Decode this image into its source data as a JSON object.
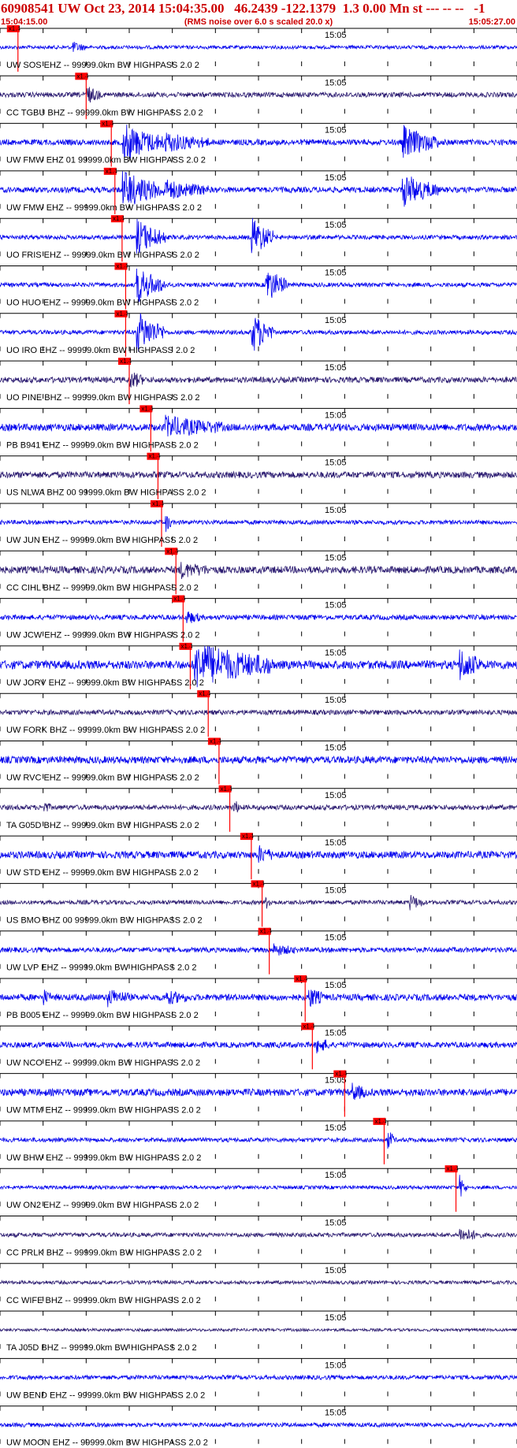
{
  "header": {
    "title": "60908541 UW Oct 23, 2014 15:04:35.00   46.2439 -122.1379  1.3 0.00 Mn st --- -- --   -1",
    "start_time": "15:04:15.00",
    "end_time": "15:05:27.00",
    "rms_note": "(RMS noise over 6.0 s scaled 20.0 x)"
  },
  "chart_data": {
    "type": "line",
    "x_start": "15:04:15.00",
    "x_end": "15:05:27.00",
    "x_tick_label": "15:05",
    "pick_label": "x1.4",
    "colors": {
      "blue": "#0000ee",
      "purple": "#2a1a70",
      "pick": "#ff0000",
      "pick_box": "#ff0000"
    },
    "traces": [
      {
        "label": "UW SOS EHZ -- 99999.0km BW  HIGHPASS  2.0  2",
        "color": "blue",
        "pick_s": 2.5,
        "amp": 0.25,
        "bursts": [
          [
            10,
            0.7,
            2
          ]
        ]
      },
      {
        "label": "CC TGBU BHZ -- 99999.0km BW  HIGHPASS  2.0  2",
        "color": "purple",
        "pick_s": 12.0,
        "amp": 0.35,
        "bursts": [
          [
            12,
            1.2,
            2
          ]
        ]
      },
      {
        "label": "UW FMW EHZ 01 99999.0km BW  HIGHPASS  2.0  2",
        "color": "blue",
        "pick_s": 15.5,
        "amp": 0.4,
        "bursts": [
          [
            17,
            2.6,
            6
          ],
          [
            23,
            1.2,
            6
          ],
          [
            56,
            2.2,
            5
          ]
        ]
      },
      {
        "label": "UW FMW EHZ -- 99999.0km BW  HIGHPASS  2.0  2",
        "color": "blue",
        "pick_s": 16.0,
        "amp": 0.4,
        "bursts": [
          [
            17,
            2.6,
            6
          ],
          [
            23,
            1.2,
            6
          ],
          [
            56,
            2.2,
            5
          ]
        ]
      },
      {
        "label": "UO FRIS EHZ -- 99999.0km BW  HIGHPASS  2.0  2",
        "color": "blue",
        "pick_s": 17.0,
        "amp": 0.3,
        "bursts": [
          [
            19,
            2.6,
            4
          ],
          [
            35,
            3.0,
            3
          ]
        ]
      },
      {
        "label": "UO HUO EHZ -- 99999.0km BW  HIGHPASS  2.0  2",
        "color": "blue",
        "pick_s": 17.5,
        "amp": 0.3,
        "bursts": [
          [
            19,
            2.6,
            4
          ],
          [
            37,
            2.6,
            3
          ]
        ]
      },
      {
        "label": "UO IRO EHZ -- 99999.0km BW  HIGHPASS  2.0  2",
        "color": "blue",
        "pick_s": 17.5,
        "amp": 0.3,
        "bursts": [
          [
            19,
            3.0,
            4
          ],
          [
            35,
            3.0,
            3
          ]
        ]
      },
      {
        "label": "UO PINE BHZ -- 99999.0km BW  HIGHPASS  2.0  2",
        "color": "purple",
        "pick_s": 18.0,
        "amp": 0.4,
        "bursts": [
          [
            18,
            1.2,
            2
          ]
        ]
      },
      {
        "label": "PB B941 EHZ -- 99999.0km BW  HIGHPASS  2.0  2",
        "color": "blue",
        "pick_s": 21.0,
        "amp": 0.5,
        "bursts": [
          [
            23,
            1.3,
            8
          ]
        ]
      },
      {
        "label": "US NLWA BHZ 00 99999.0km BW  HIGHPASS  2.0  2",
        "color": "purple",
        "pick_s": 22.0,
        "amp": 0.45,
        "bursts": []
      },
      {
        "label": "UW JUN EHZ -- 99999.0km BW  HIGHPASS  2.0  2",
        "color": "blue",
        "pick_s": 22.5,
        "amp": 0.3,
        "bursts": [
          [
            23,
            1.4,
            1
          ]
        ]
      },
      {
        "label": "CC CIHL BHZ -- 99999.0km BW  HIGHPASS  2.0  2",
        "color": "purple",
        "pick_s": 24.5,
        "amp": 0.5,
        "bursts": [
          [
            25,
            0.9,
            4
          ]
        ]
      },
      {
        "label": "UW JCW EHZ -- 99999.0km BW  HIGHPASS  2.0  2",
        "color": "blue",
        "pick_s": 25.5,
        "amp": 0.35,
        "bursts": [
          [
            26,
            0.8,
            2
          ]
        ]
      },
      {
        "label": "UW JORV EHZ -- 99999.0km BW  HIGHPASS  2.0  2",
        "color": "blue",
        "pick_s": 26.5,
        "amp": 0.6,
        "bursts": [
          [
            27,
            3.0,
            11
          ],
          [
            64,
            2.0,
            3
          ]
        ]
      },
      {
        "label": "UW FORK BHZ -- 99999.0km BW  HIGHPASS  2.0  2",
        "color": "purple",
        "pick_s": 29.0,
        "amp": 0.35,
        "bursts": []
      },
      {
        "label": "UW RVC EHZ -- 99999.0km BW  HIGHPASS  2.0  2",
        "color": "blue",
        "pick_s": 30.5,
        "amp": 0.5,
        "bursts": []
      },
      {
        "label": "TA G05D BHZ -- 99999.0km BW  HIGHPASS  2.0  2",
        "color": "purple",
        "pick_s": 32.0,
        "amp": 0.35,
        "bursts": [
          [
            32.5,
            1.0,
            1
          ],
          [
            6,
            0.8,
            1
          ]
        ]
      },
      {
        "label": "UW STD EHZ -- 99999.0km BW  HIGHPASS  2.0  2",
        "color": "blue",
        "pick_s": 35.0,
        "amp": 0.5,
        "bursts": [
          [
            36,
            1.0,
            2
          ]
        ]
      },
      {
        "label": "US BMO BHZ 00 99999.0km BW  HIGHPASS  2.0  2",
        "color": "purple",
        "pick_s": 36.5,
        "amp": 0.3,
        "bursts": [
          [
            37,
            0.8,
            1
          ],
          [
            57,
            1.0,
            2
          ]
        ]
      },
      {
        "label": "UW LVP EHZ -- 99999.0km BW  HIGHPASS  2.0  2",
        "color": "blue",
        "pick_s": 37.5,
        "amp": 0.35,
        "bursts": [
          [
            38,
            0.7,
            3
          ]
        ]
      },
      {
        "label": "PB B005 EHZ -- 99999.0km BW  HIGHPASS  2.0  2",
        "color": "blue",
        "pick_s": 42.5,
        "amp": 0.45,
        "bursts": [
          [
            6,
            1.0,
            1
          ],
          [
            15,
            1.0,
            3
          ],
          [
            23,
            0.8,
            3
          ],
          [
            43,
            1.3,
            2
          ]
        ]
      },
      {
        "label": "UW NCO EHZ -- 99999.0km BW  HIGHPASS  2.0  2",
        "color": "blue",
        "pick_s": 43.5,
        "amp": 0.4,
        "bursts": [
          [
            44,
            1.0,
            2
          ]
        ]
      },
      {
        "label": "UW MTM EHZ -- 99999.0km BW  HIGHPASS  2.0  2",
        "color": "blue",
        "pick_s": 48.0,
        "amp": 0.5,
        "bursts": [
          [
            49,
            1.0,
            2
          ]
        ]
      },
      {
        "label": "UW BHW EHZ -- 99999.0km BW  HIGHPASS  2.0  2",
        "color": "blue",
        "pick_s": 53.5,
        "amp": 0.3,
        "bursts": [
          [
            54,
            1.4,
            1
          ]
        ]
      },
      {
        "label": "UW ON2 EHZ -- 99999.0km BW  HIGHPASS  2.0  2",
        "color": "blue",
        "pick_s": 63.5,
        "amp": 0.25,
        "bursts": [
          [
            64,
            1.6,
            1
          ]
        ]
      },
      {
        "label": "CC PRLK BHZ -- 99999.0km BW  HIGHPASS  2.0  2",
        "color": "purple",
        "pick_s": null,
        "amp": 0.3,
        "bursts": [
          [
            64,
            1.0,
            3
          ]
        ]
      },
      {
        "label": "CC WIFE BHZ -- 99999.0km BW  HIGHPASS  2.0  2",
        "color": "purple",
        "pick_s": null,
        "amp": 0.25,
        "bursts": []
      },
      {
        "label": "TA J05D BHZ -- 99999.0km BW  HIGHPASS  2.0  2",
        "color": "purple",
        "pick_s": null,
        "amp": 0.2,
        "bursts": []
      },
      {
        "label": "UW BEND EHZ -- 99999.0km BW  HIGHPASS  2.0  2",
        "color": "blue",
        "pick_s": null,
        "amp": 0.3,
        "bursts": []
      },
      {
        "label": "UW MOON EHZ -- 99999.0km BW  HIGHPASS  2.0  2",
        "color": "blue",
        "pick_s": null,
        "amp": 0.3,
        "bursts": []
      }
    ]
  }
}
